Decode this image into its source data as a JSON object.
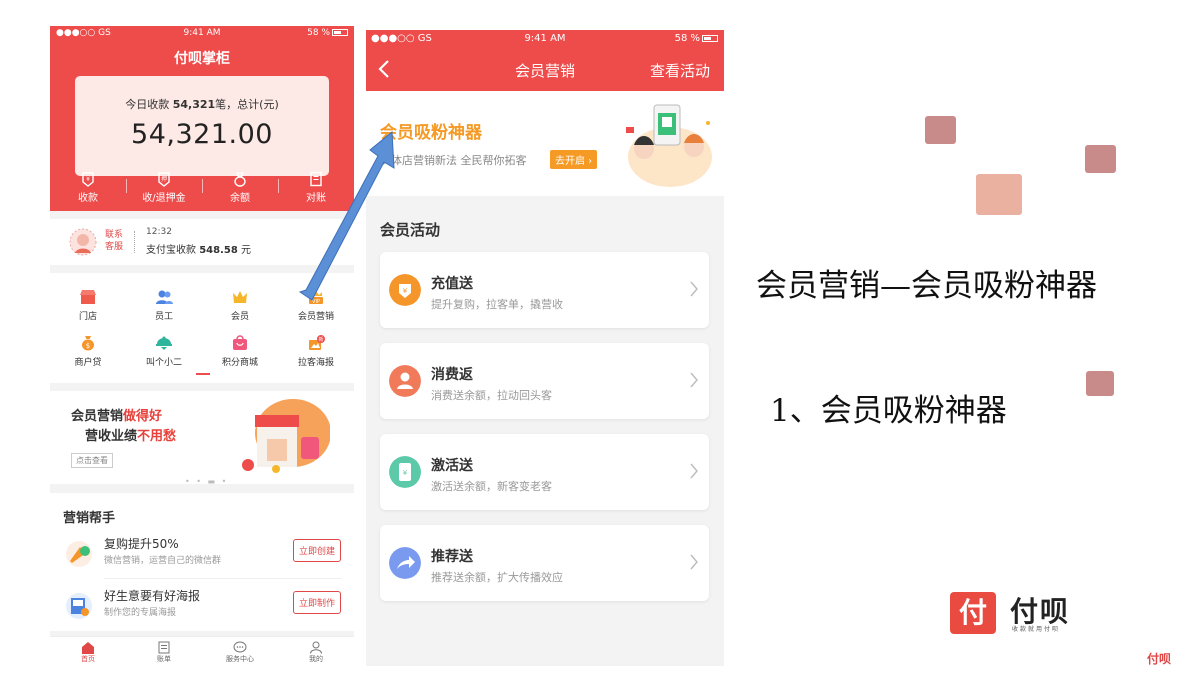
{
  "phone1": {
    "status": {
      "carrier": "●●●○○ GS",
      "time": "9:41 AM",
      "battery": "58 %"
    },
    "title": "付呗掌柜",
    "income": {
      "prefix": "今日收款",
      "count": "54,321",
      "suffix": "笔，总计(元)",
      "amount": "54,321.00"
    },
    "actions": [
      {
        "label": "收款",
        "icon": "collect-icon"
      },
      {
        "label": "收/退押金",
        "icon": "deposit-icon"
      },
      {
        "label": "余额",
        "icon": "balance-icon"
      },
      {
        "label": "对账",
        "icon": "reconcile-icon"
      }
    ],
    "support": {
      "tag": "联系客服",
      "time": "12:32",
      "message_prefix": "支付宝收款",
      "message_amount": "548.58",
      "message_unit": "元"
    },
    "grid": [
      {
        "label": "门店",
        "icon": "store-icon"
      },
      {
        "label": "员工",
        "icon": "staff-icon"
      },
      {
        "label": "会员",
        "icon": "crown-icon"
      },
      {
        "label": "会员营销",
        "icon": "vip-icon",
        "badge": "VIP"
      },
      {
        "label": "商户贷",
        "icon": "loan-icon"
      },
      {
        "label": "叫个小二",
        "icon": "waiter-icon"
      },
      {
        "label": "积分商城",
        "icon": "points-mall-icon"
      },
      {
        "label": "拉客海报",
        "icon": "poster-icon",
        "badge": "新"
      }
    ],
    "banner": {
      "line1_plain": "会员营销",
      "line1_highlight": "做得好",
      "line2_plain": "营收业绩",
      "line2_highlight": "不用愁",
      "button": "点击查看"
    },
    "helper": {
      "title": "营销帮手",
      "items": [
        {
          "name": "复购提升50%",
          "desc": "微信营销，运营自己的微信群",
          "action": "立即创建"
        },
        {
          "name": "好生意要有好海报",
          "desc": "制作您的专属海报",
          "action": "立即制作"
        }
      ]
    },
    "tabs": [
      {
        "label": "首页",
        "icon": "home-icon"
      },
      {
        "label": "账单",
        "icon": "bill-icon"
      },
      {
        "label": "服务中心",
        "icon": "service-icon"
      },
      {
        "label": "我的",
        "icon": "profile-icon"
      }
    ]
  },
  "phone2": {
    "status": {
      "carrier": "●●●○○ GS",
      "time": "9:41 AM",
      "battery": "58 %"
    },
    "title": "会员营销",
    "right_action": "查看活动",
    "promo": {
      "title": "会员吸粉神器",
      "desc": "实体店营销新法 全民帮你拓客",
      "button": "去开启"
    },
    "section_title": "会员活动",
    "activities": [
      {
        "name": "充值送",
        "desc": "提升复购，拉客单，撬营收",
        "icon": "recharge-gift-icon",
        "color": "#f5962a"
      },
      {
        "name": "消费返",
        "desc": "消费送余额，拉动回头客",
        "icon": "cashback-icon",
        "color": "#f07a5a"
      },
      {
        "name": "激活送",
        "desc": "激活送余额，新客变老客",
        "icon": "activate-icon",
        "color": "#5cc9a8"
      },
      {
        "name": "推荐送",
        "desc": "推荐送余额，扩大传播效应",
        "icon": "referral-icon",
        "color": "#7a9af0"
      }
    ]
  },
  "slide": {
    "heading": "会员营销—会员吸粉神器",
    "point": "1、会员吸粉神器",
    "brand_name": "付呗",
    "brand_slogan": "收款就用付呗",
    "corner_label": "付呗"
  },
  "colors": {
    "brand_red": "#ee4b4b",
    "promo_orange": "#f59a24",
    "arrow_blue": "#5b8fd6",
    "square_rose": "#c98a8a"
  }
}
